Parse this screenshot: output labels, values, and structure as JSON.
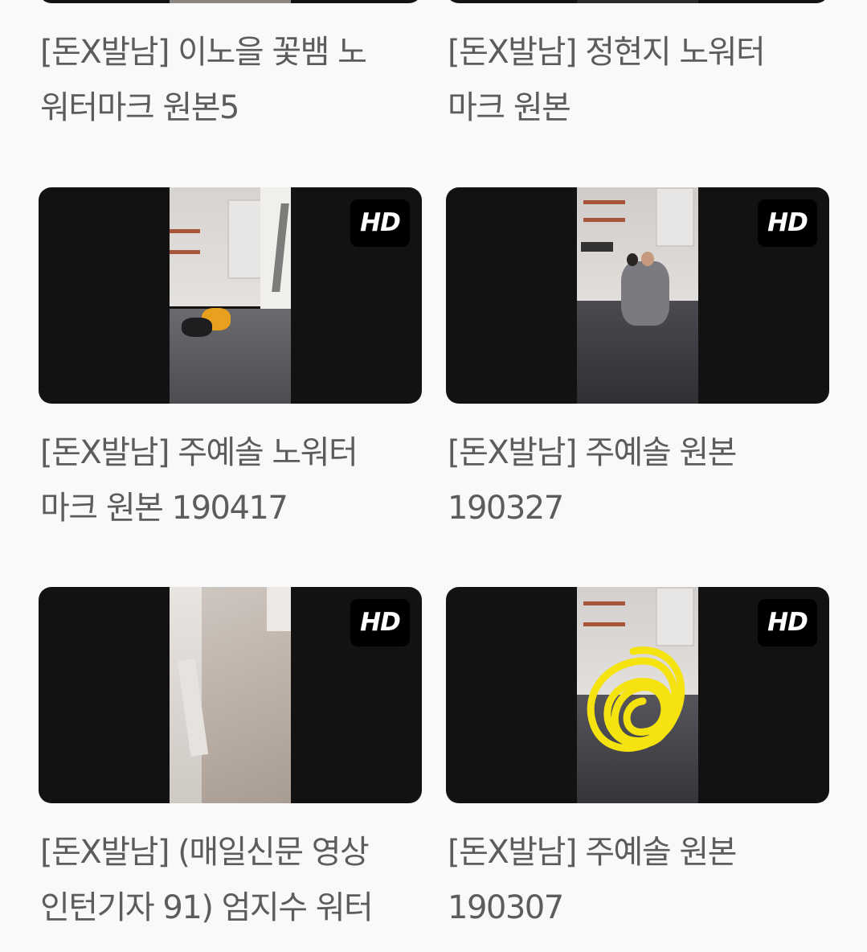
{
  "hd_label": "HD",
  "top_row": [
    {
      "title_lines": [
        "[돈X발남] 이노을 꽃뱀 노",
        "워터마크 원본5"
      ]
    },
    {
      "title_lines": [
        "[돈X발남] 정현지 노워터",
        "마크 원본"
      ]
    }
  ],
  "cards": [
    {
      "title_lines": [
        "[돈X발남] 주예솔 노워터",
        "마크 원본 190417"
      ]
    },
    {
      "title_lines": [
        "[돈X발남] 주예솔 원본",
        "190327"
      ]
    },
    {
      "title_lines": [
        "[돈X발남] (매일신문 영상",
        "인턴기자 91) 엄지수 워터"
      ]
    },
    {
      "title_lines": [
        "[돈X발남] 주예솔 원본",
        "190307"
      ]
    }
  ],
  "colors": {
    "background": "#f9f9fa",
    "thumbnail_bg": "#121212",
    "title_text": "#5c5c5c",
    "badge_bg": "#000000",
    "badge_text": "#ffffff"
  }
}
